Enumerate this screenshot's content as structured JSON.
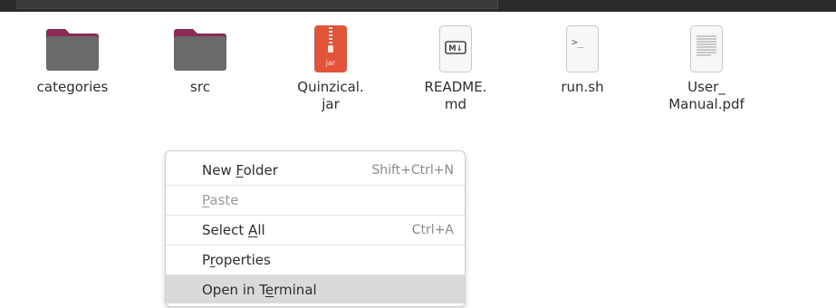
{
  "files": [
    {
      "name": "categories",
      "icon": "folder-icon"
    },
    {
      "name": "src",
      "icon": "folder-icon"
    },
    {
      "name": "Quinzical.\njar",
      "icon": "jar-archive-icon",
      "badge": "jar"
    },
    {
      "name": "README.\nmd",
      "icon": "markdown-file-icon",
      "badge": "M↓"
    },
    {
      "name": "run.sh",
      "icon": "shell-script-icon",
      "badge": ">_"
    },
    {
      "name": "User_\nManual.pdf",
      "icon": "pdf-document-icon"
    }
  ],
  "context_menu": {
    "items": [
      {
        "pre": "New ",
        "u": "F",
        "post": "older",
        "shortcut": "Shift+Ctrl+N",
        "state": "normal"
      },
      {
        "pre": "",
        "u": "P",
        "post": "aste",
        "shortcut": "",
        "state": "disabled"
      },
      {
        "pre": "Select ",
        "u": "A",
        "post": "ll",
        "shortcut": "Ctrl+A",
        "state": "normal"
      },
      {
        "pre": "P",
        "u": "r",
        "post": "operties",
        "shortcut": "",
        "state": "normal"
      },
      {
        "pre": "Open in T",
        "u": "e",
        "post": "rminal",
        "shortcut": "",
        "state": "hover"
      }
    ]
  },
  "colors": {
    "folder_body": "#6a6a6a",
    "folder_tab": "#8a2a55",
    "jar_orange": "#e2543a",
    "topbar": "#2b2b2b",
    "menu_hover": "#dadada"
  }
}
